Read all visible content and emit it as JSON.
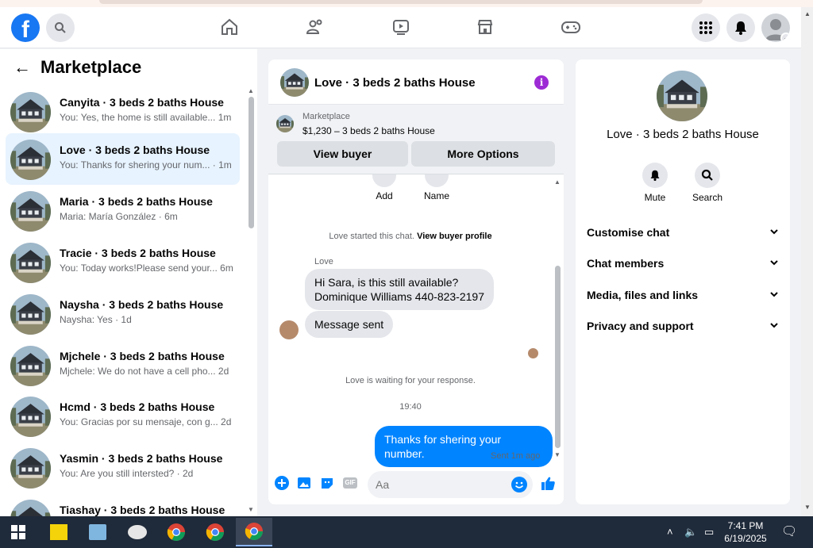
{
  "marketplace": {
    "title": "Marketplace",
    "conversations": [
      {
        "name": "Canyita · 3 beds 2 baths House",
        "preview": "You: Yes, the home is still available...",
        "time": "1m"
      },
      {
        "name": "Love · 3 beds 2 baths House",
        "preview": "You: Thanks for shering your num...",
        "time": "· 1m"
      },
      {
        "name": "Maria · 3 beds 2 baths House",
        "preview": "Maria: María González",
        "time": "· 6m"
      },
      {
        "name": "Tracie · 3 beds 2 baths House",
        "preview": "You: Today works!Please send your...",
        "time": "6m"
      },
      {
        "name": "Naysha · 3 beds 2 baths House",
        "preview": "Naysha: Yes",
        "time": "· 1d"
      },
      {
        "name": "Mjchele · 3 beds 2 baths House",
        "preview": "Mjchele: We do not have a cell pho...",
        "time": "2d"
      },
      {
        "name": "Hcmd · 3 beds 2 baths House",
        "preview": "You: Gracias por su mensaje, con g...",
        "time": "2d"
      },
      {
        "name": "Yasmin · 3 beds 2 baths House",
        "preview": "You: Are you still intersted?",
        "time": "· 2d"
      },
      {
        "name": "Tiashay · 3 beds 2 baths House",
        "preview": "",
        "time": ""
      }
    ]
  },
  "chat": {
    "title": "Love · 3 beds 2 baths House",
    "info_icon": "i",
    "listing_label": "Marketplace",
    "listing_price": "$1,230 – 3 beds 2 baths House",
    "view_buyer": "View buyer",
    "more_options": "More Options",
    "actions": {
      "add": "Add",
      "name": "Name"
    },
    "started_text": "Love started this chat.",
    "view_buyer_profile": "View buyer profile",
    "sender_name": "Love",
    "incoming_1_line1": "Hi Sara, is this still available?",
    "incoming_1_line2": "Dominique Williams 440-823-2197",
    "incoming_2": "Message sent",
    "waiting": "Love is waiting for your response.",
    "timestamp": "19:40",
    "outgoing": "Thanks for shering your number.",
    "sent_status": "Sent 1m ago",
    "composer_placeholder": "Aa",
    "gif_label": "GIF"
  },
  "details": {
    "title": "Love · 3 beds 2 baths House",
    "mute": "Mute",
    "search": "Search",
    "sections": [
      "Customise chat",
      "Chat members",
      "Media, files and links",
      "Privacy and support"
    ]
  },
  "taskbar": {
    "time": "7:41 PM",
    "date": "6/19/2025"
  },
  "colors": {
    "facebook_blue": "#1877f2",
    "messenger_blue": "#0084ff",
    "active_row": "#e7f3ff",
    "info_purple": "#9d2bd5"
  }
}
